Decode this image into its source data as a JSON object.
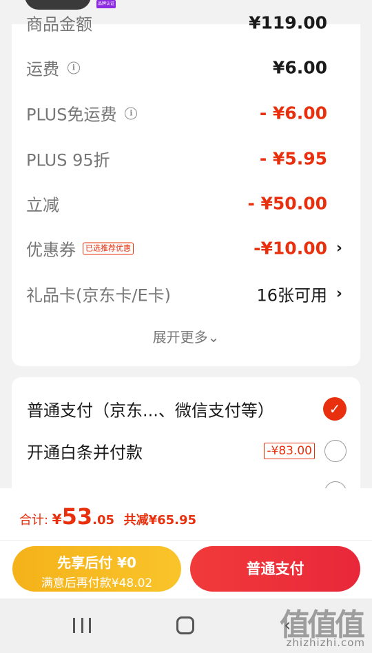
{
  "header_badge": "品牌认证",
  "summary": {
    "rows": [
      {
        "label": "商品金额",
        "value": "¥119.00",
        "value_style": "dark"
      },
      {
        "label": "运费",
        "value": "¥6.00",
        "value_style": "dark",
        "icon": "info-icon"
      },
      {
        "label": "PLUS免运费",
        "value": "- ¥6.00",
        "value_style": "red",
        "icon": "info-icon"
      },
      {
        "label": "PLUS 95折",
        "value": "- ¥5.95",
        "value_style": "red"
      },
      {
        "label": "立减",
        "value": "- ¥50.00",
        "value_style": "red"
      },
      {
        "label": "优惠券",
        "tag": "已选推荐优惠",
        "value": "-¥10.00",
        "value_style": "red",
        "chevron": "›"
      },
      {
        "label": "礼品卡(京东卡/E卡)",
        "value": "16张可用",
        "value_style": "dark",
        "chevron": "›"
      }
    ],
    "expand_label": "展开更多⌄"
  },
  "payment": {
    "options": [
      {
        "label": "普通支付（京东...、微信支付等）",
        "selected": true
      },
      {
        "label": "开通白条并付款",
        "discount": "-¥83.00",
        "selected": false
      },
      {
        "label": "",
        "selected": false
      }
    ]
  },
  "footer": {
    "total_label": "合计:",
    "total_yen": "¥",
    "total_int": "53",
    "total_dec": ".05",
    "saved": "共减¥65.95",
    "later_pay_title": "先享后付 ¥0",
    "later_pay_sub": "满意后再付款¥48.02",
    "normal_pay": "普通支付"
  },
  "watermark": {
    "logo": "值值值",
    "site": "zhizhizhi.com"
  },
  "colors": {
    "accent": "#e8300e",
    "yellow": "#f5b21a",
    "red_button": "#f13a3a"
  }
}
